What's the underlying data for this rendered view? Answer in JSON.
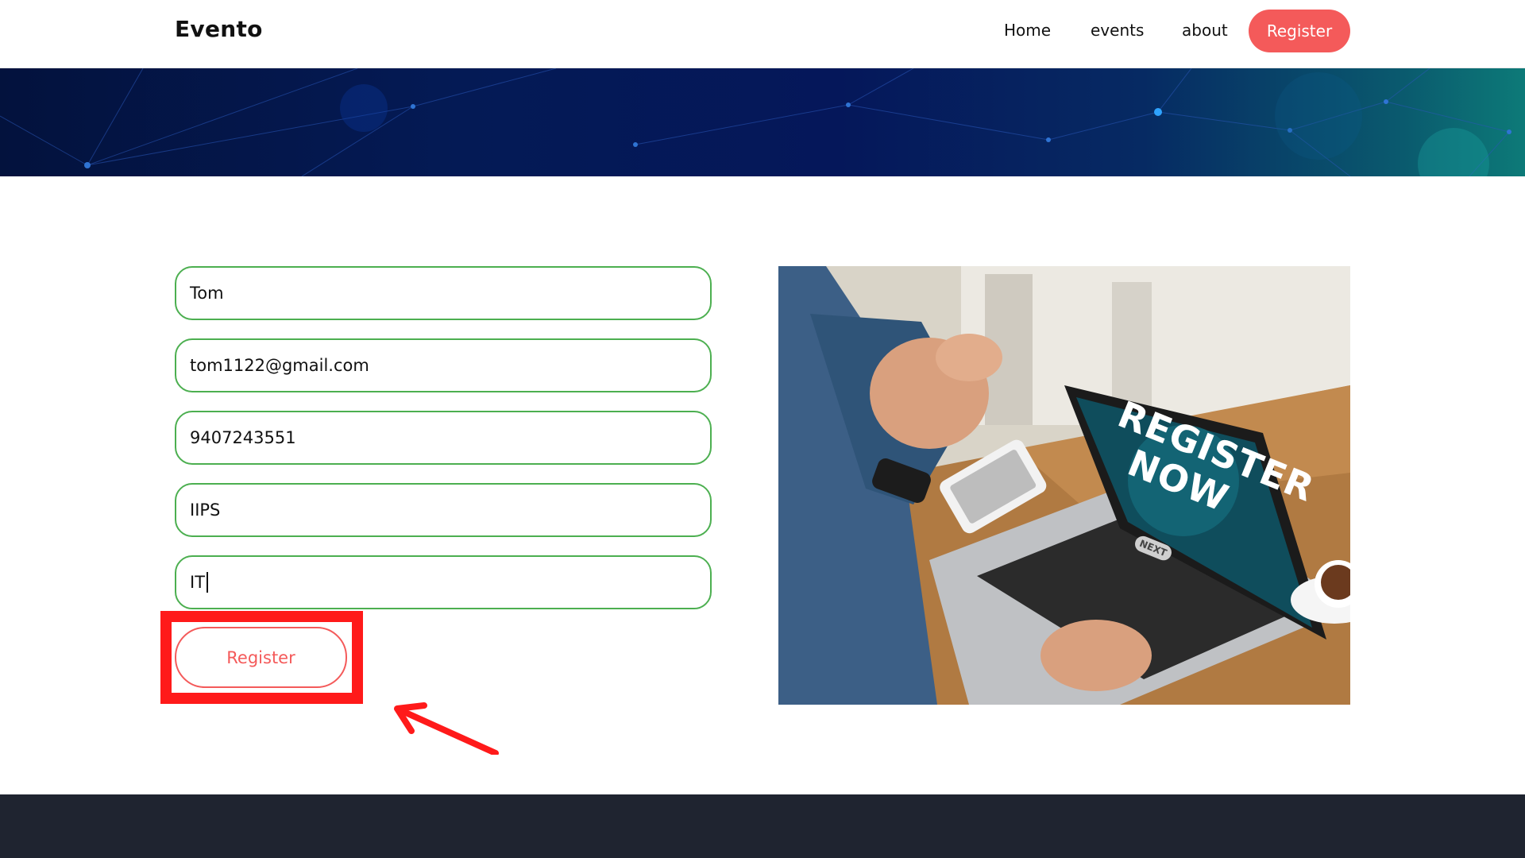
{
  "navbar": {
    "brand": "Evento",
    "links": [
      {
        "label": "Home"
      },
      {
        "label": "events"
      },
      {
        "label": "about"
      }
    ],
    "register_label": "Register"
  },
  "form": {
    "name_value": "Tom",
    "email_value": "tom1122@gmail.com",
    "phone_value": "9407243551",
    "college_value": "IIPS",
    "branch_value": "IT",
    "submit_label": "Register"
  },
  "promo": {
    "image_text": "REGISTER NOW",
    "image_button": "NEXT"
  },
  "colors": {
    "accent": "#f45a5a",
    "field_border": "#4caf50",
    "annotation": "#ff1a1a",
    "footer": "#1f2430"
  }
}
